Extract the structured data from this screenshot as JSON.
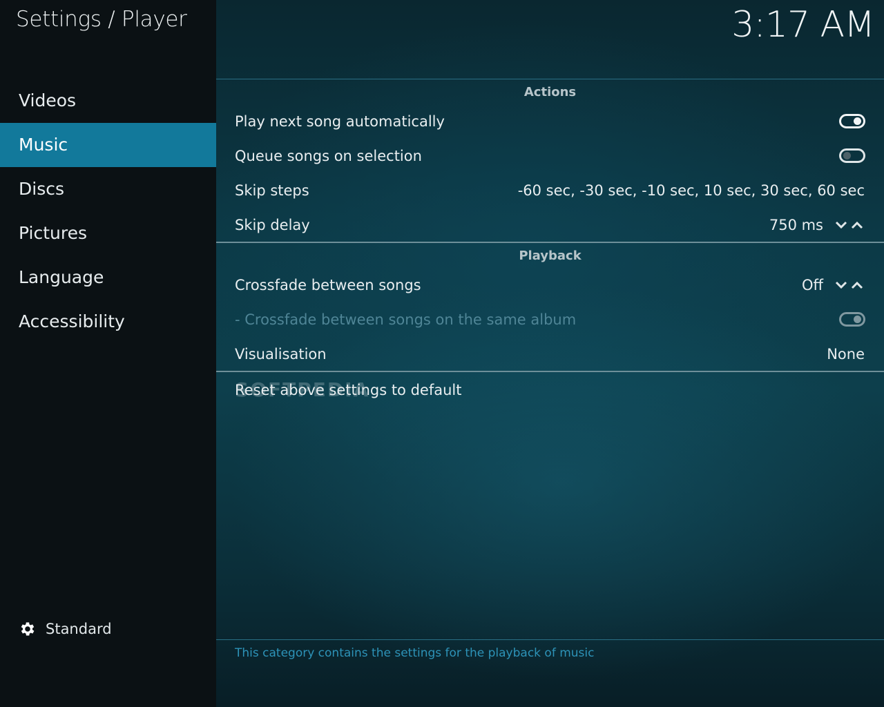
{
  "header": {
    "title": "Settings / Player",
    "clock": "3:17 AM"
  },
  "sidebar": {
    "items": [
      {
        "label": "Videos"
      },
      {
        "label": "Music"
      },
      {
        "label": "Discs"
      },
      {
        "label": "Pictures"
      },
      {
        "label": "Language"
      },
      {
        "label": "Accessibility"
      }
    ],
    "active_index": 1,
    "level": {
      "label": "Standard",
      "icon": "gear-icon"
    }
  },
  "sections": {
    "actions": {
      "header": "Actions",
      "play_next": {
        "label": "Play next song automatically",
        "state": "on"
      },
      "queue_songs": {
        "label": "Queue songs on selection",
        "state": "off"
      },
      "skip_steps": {
        "label": "Skip steps",
        "value": "-60 sec, -30 sec, -10 sec, 10 sec, 30 sec, 60 sec"
      },
      "skip_delay": {
        "label": "Skip delay",
        "value": "750 ms"
      }
    },
    "playback": {
      "header": "Playback",
      "crossfade": {
        "label": "Crossfade between songs",
        "value": "Off"
      },
      "crossfade_album": {
        "label": "- Crossfade between songs on the same album",
        "state": "on",
        "enabled": false
      },
      "visualisation": {
        "label": "Visualisation",
        "value": "None"
      }
    },
    "reset": {
      "label": "Reset above settings to default"
    }
  },
  "description": "This category contains the settings for the playback of music",
  "watermark": "SOFTPEDIA",
  "colors": {
    "accent": "#12799b",
    "description_text": "#2d93b8"
  }
}
